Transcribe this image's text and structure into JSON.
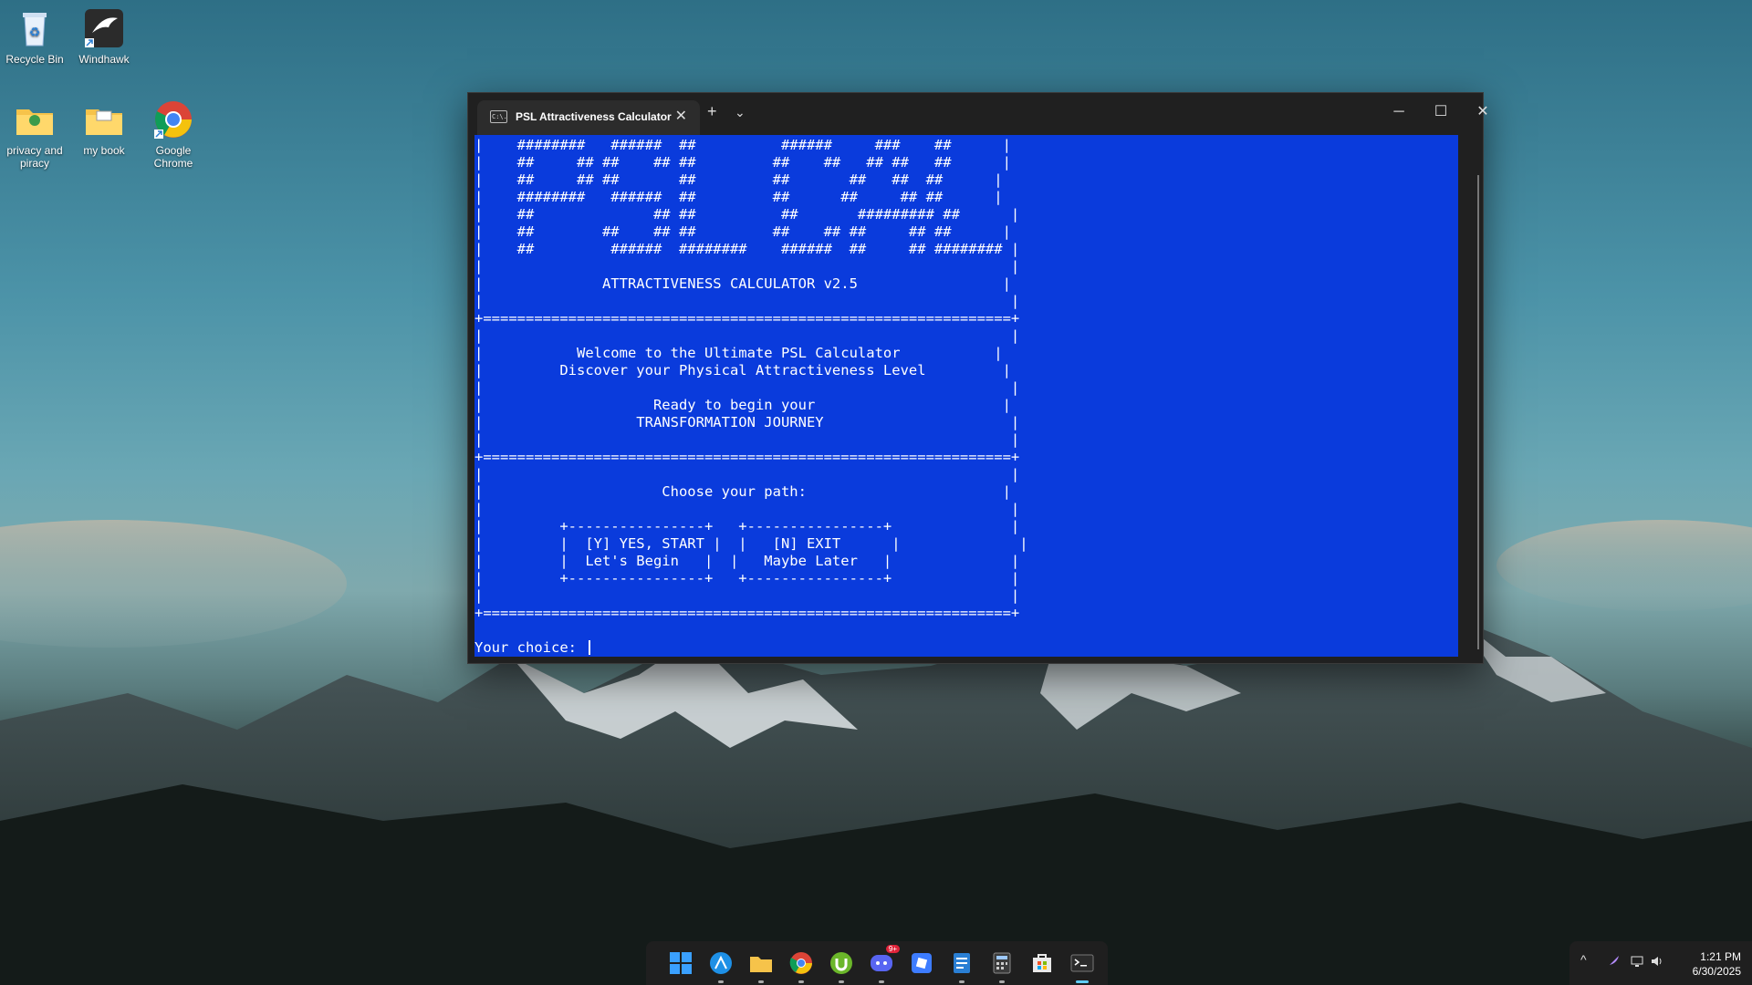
{
  "desktop": {
    "icons": [
      {
        "label": "Recycle Bin"
      },
      {
        "label": "Windhawk"
      },
      {
        "label": "privacy and piracy"
      },
      {
        "label": "my book"
      },
      {
        "label": "Google Chrome"
      }
    ]
  },
  "window": {
    "tab_title": "PSL Attractiveness Calculator",
    "tab_icon_text": "C:\\.",
    "new_tab_glyph": "+",
    "dropdown_glyph": "⌄",
    "minimize_glyph": "─",
    "maximize_glyph": "☐",
    "close_glyph": "✕"
  },
  "console": {
    "text": "|    ########   ######  ##          ######     ###    ##      |\n|    ##     ## ##    ## ##         ##    ##   ## ##   ##      |\n|    ##     ## ##       ##         ##       ##   ##  ##      |\n|    ########   ######  ##         ##      ##     ## ##      |\n|    ##              ## ##          ##       ######### ##      |\n|    ##        ##    ## ##         ##    ## ##     ## ##      |\n|    ##         ######  ########    ######  ##     ## ######## |\n|                                                              |\n|              ATTRACTIVENESS CALCULATOR v2.5                 |\n|                                                              |\n+==============================================================+\n|                                                              |\n|           Welcome to the Ultimate PSL Calculator           |\n|         Discover your Physical Attractiveness Level         |\n|                                                              |\n|                    Ready to begin your                      |\n|                  TRANSFORMATION JOURNEY                      |\n|                                                              |\n+==============================================================+\n|                                                              |\n|                     Choose your path:                       |\n|                                                              |\n|         +----------------+   +----------------+              |\n|         |  [Y] YES, START |  |   [N] EXIT      |              |\n|         |  Let's Begin   |  |   Maybe Later   |              |\n|         +----------------+   +----------------+              |\n|                                                              |\n+==============================================================+\n\nYour choice: ",
    "prompt": "Your choice: "
  },
  "tray": {
    "time": "1:21 PM",
    "date": "6/30/2025",
    "chevron": "^"
  },
  "taskbar": {
    "discord_badge": "9+"
  }
}
